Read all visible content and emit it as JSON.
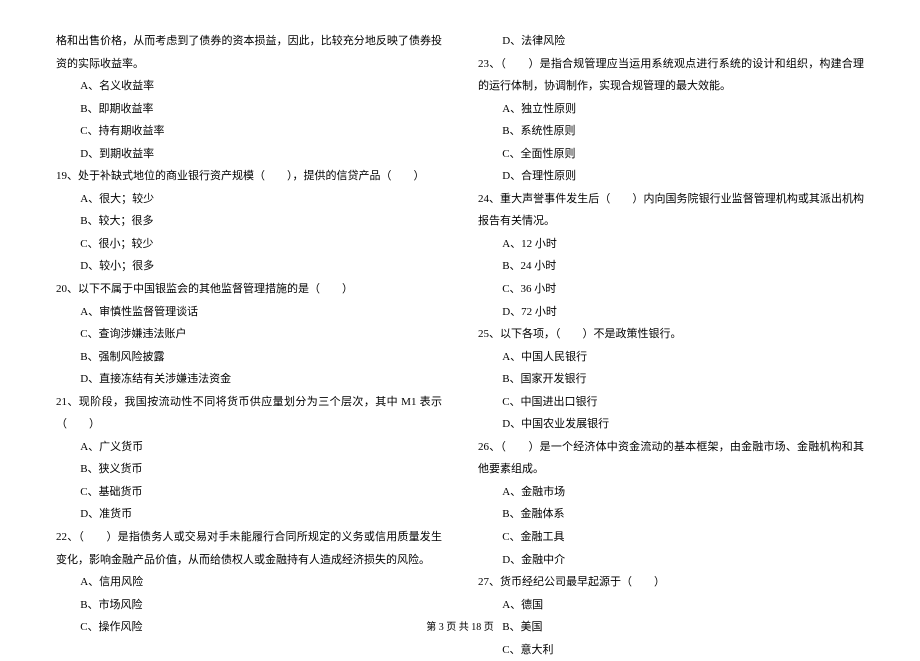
{
  "left": {
    "continuation": "格和出售价格，从而考虑到了债券的资本损益，因此，比较充分地反映了债券投资的实际收益率。",
    "q18_opts": [
      "A、名义收益率",
      "B、即期收益率",
      "C、持有期收益率",
      "D、到期收益率"
    ],
    "q19_text": "19、处于补缺式地位的商业银行资产规模（　　），提供的信贷产品（　　）",
    "q19_opts": [
      "A、很大；较少",
      "B、较大；很多",
      "C、很小；较少",
      "D、较小；很多"
    ],
    "q20_text": "20、以下不属于中国银监会的其他监督管理措施的是（　　）",
    "q20_opts": [
      "A、审慎性监督管理谈话",
      "C、查询涉嫌违法账户",
      "B、强制风险披露",
      "D、直接冻结有关涉嫌违法资金"
    ],
    "q21_text": "21、现阶段，我国按流动性不同将货币供应量划分为三个层次，其中 M1 表示（　　）",
    "q21_opts": [
      "A、广义货币",
      "B、狭义货币",
      "C、基础货币",
      "D、准货币"
    ],
    "q22_text": "22、（　　）是指债务人或交易对手未能履行合同所规定的义务或信用质量发生变化，影响金融产品价值，从而给债权人或金融持有人造成经济损失的风险。",
    "q22_opts": [
      "A、信用风险",
      "B、市场风险",
      "C、操作风险"
    ]
  },
  "right": {
    "q22_opt_d": "D、法律风险",
    "q23_text": "23、（　　）是指合规管理应当运用系统观点进行系统的设计和组织，构建合理的运行体制，协调制作，实现合规管理的最大效能。",
    "q23_opts": [
      "A、独立性原则",
      "B、系统性原则",
      "C、全面性原则",
      "D、合理性原则"
    ],
    "q24_text": "24、重大声誉事件发生后（　　）内向国务院银行业监督管理机构或其派出机构报告有关情况。",
    "q24_opts": [
      "A、12 小时",
      "B、24 小时",
      "C、36 小时",
      "D、72 小时"
    ],
    "q25_text": "25、以下各项，（　　）不是政策性银行。",
    "q25_opts": [
      "A、中国人民银行",
      "B、国家开发银行",
      "C、中国进出口银行",
      "D、中国农业发展银行"
    ],
    "q26_text": "26、（　　）是一个经济体中资金流动的基本框架，由金融市场、金融机构和其他要素组成。",
    "q26_opts": [
      "A、金融市场",
      "B、金融体系",
      "C、金融工具",
      "D、金融中介"
    ],
    "q27_text": "27、货币经纪公司最早起源于（　　）",
    "q27_opts": [
      "A、德国",
      "B、美国",
      "C、意大利"
    ]
  },
  "footer": "第 3 页 共 18 页"
}
